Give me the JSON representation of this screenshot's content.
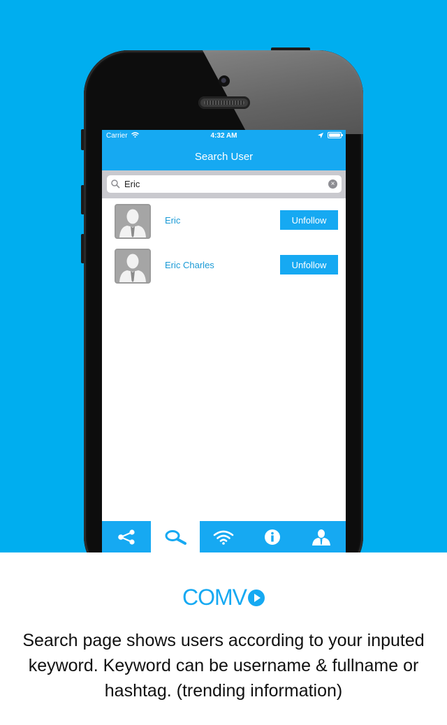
{
  "status_bar": {
    "carrier": "Carrier",
    "time": "4:32 AM"
  },
  "nav": {
    "title": "Search User"
  },
  "search": {
    "value": "Eric",
    "clear_glyph": "×"
  },
  "users": [
    {
      "name": "Eric",
      "action": "Unfollow"
    },
    {
      "name": "Eric Charles",
      "action": "Unfollow"
    }
  ],
  "tabs": [
    {
      "icon": "share-icon",
      "active": false
    },
    {
      "icon": "search-icon",
      "active": true
    },
    {
      "icon": "wifi-icon",
      "active": false
    },
    {
      "icon": "info-icon",
      "active": false
    },
    {
      "icon": "profile-icon",
      "active": false
    }
  ],
  "footer": {
    "brand": "COMV",
    "caption": "Search page shows users according to your inputed keyword. Keyword can be username & fullname or hashtag. (trending information)"
  },
  "colors": {
    "background": "#00aeef",
    "accent": "#16a9f2",
    "link": "#1a9ad6"
  }
}
